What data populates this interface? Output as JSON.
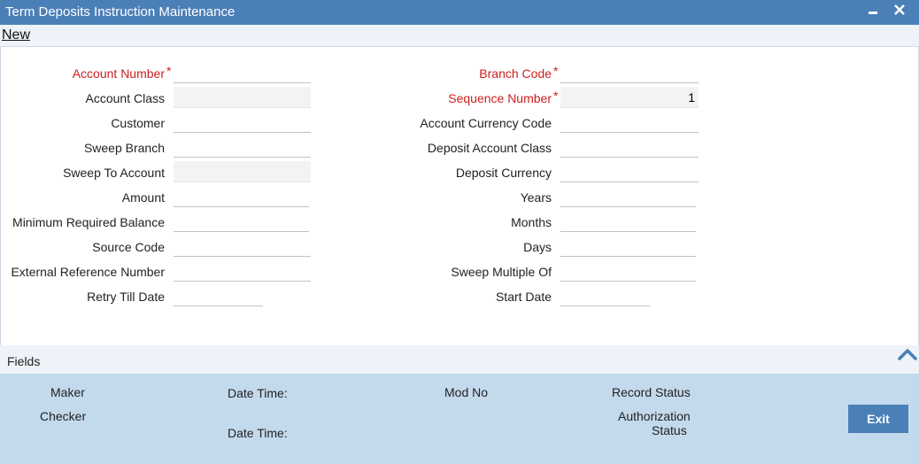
{
  "window": {
    "title": "Term Deposits Instruction Maintenance",
    "minimize_glyph": "▬",
    "close_glyph": "✕"
  },
  "toolbar": {
    "new_label": "New"
  },
  "left_fields": [
    {
      "label": "Account Number",
      "required": true,
      "value": "",
      "readonly": false
    },
    {
      "label": "Account Class",
      "required": false,
      "value": "",
      "readonly": true
    },
    {
      "label": "Customer",
      "required": false,
      "value": "",
      "readonly": false
    },
    {
      "label": "Sweep Branch",
      "required": false,
      "value": "",
      "readonly": false
    },
    {
      "label": "Sweep To Account",
      "required": false,
      "value": "",
      "readonly": true
    },
    {
      "label": "Amount",
      "required": false,
      "value": "",
      "readonly": false
    },
    {
      "label": "Minimum Required Balance",
      "required": false,
      "value": "",
      "readonly": false
    },
    {
      "label": "Source Code",
      "required": false,
      "value": "",
      "readonly": false
    },
    {
      "label": "External Reference Number",
      "required": false,
      "value": "",
      "readonly": false
    },
    {
      "label": "Retry Till Date",
      "required": false,
      "value": "",
      "readonly": false
    }
  ],
  "right_fields": [
    {
      "label": "Branch Code",
      "required": true,
      "value": "",
      "readonly": false
    },
    {
      "label": "Sequence Number",
      "required": true,
      "value": "1",
      "readonly": true
    },
    {
      "label": "Account Currency Code",
      "required": false,
      "value": "",
      "readonly": false
    },
    {
      "label": "Deposit Account Class",
      "required": false,
      "value": "",
      "readonly": false
    },
    {
      "label": "Deposit Currency",
      "required": false,
      "value": "",
      "readonly": false
    },
    {
      "label": "Years",
      "required": false,
      "value": "",
      "readonly": false
    },
    {
      "label": "Months",
      "required": false,
      "value": "",
      "readonly": false
    },
    {
      "label": "Days",
      "required": false,
      "value": "",
      "readonly": false
    },
    {
      "label": "Sweep Multiple Of",
      "required": false,
      "value": "",
      "readonly": false
    },
    {
      "label": "Start Date",
      "required": false,
      "value": "",
      "readonly": false
    }
  ],
  "fields_section": {
    "label": "Fields",
    "icon": "chevron-up-icon"
  },
  "footer": {
    "maker": "Maker",
    "checker": "Checker",
    "date_time_1": "Date Time:",
    "date_time_2": "Date Time:",
    "mod_no": "Mod No",
    "record_status": "Record Status",
    "authorization_status_line1": "Authorization",
    "authorization_status_line2": "Status",
    "exit_label": "Exit"
  },
  "colors": {
    "title_bar": "#4b7fb8",
    "required_label": "#cc1f1f",
    "footer_bg": "#c3d9ec",
    "exit_button": "#4a80b6"
  }
}
